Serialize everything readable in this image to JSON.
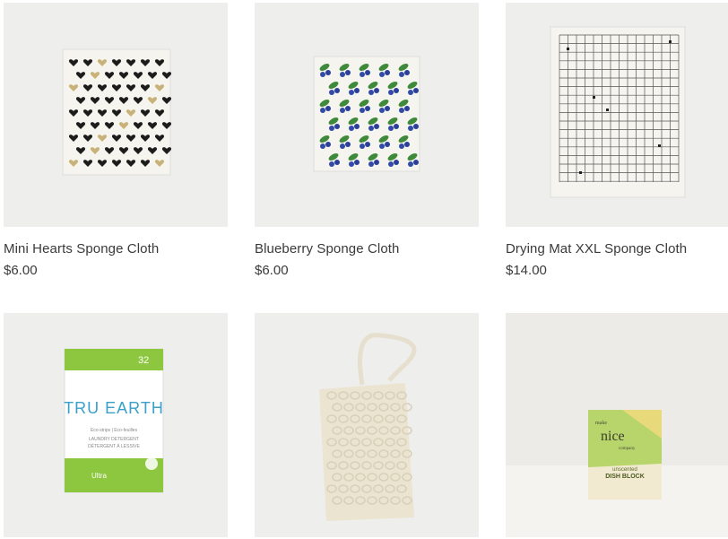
{
  "products": [
    {
      "title": "Mini Hearts Sponge Cloth",
      "price": "$6.00",
      "image": "mini-hearts-sponge-cloth-image"
    },
    {
      "title": "Blueberry Sponge Cloth",
      "price": "$6.00",
      "image": "blueberry-sponge-cloth-image"
    },
    {
      "title": "Drying Mat XXL Sponge Cloth",
      "price": "$14.00",
      "image": "drying-mat-sponge-cloth-image"
    },
    {
      "title": "",
      "price": "",
      "image": "tru-earth-laundry-strips-image"
    },
    {
      "title": "",
      "price": "",
      "image": "sisal-soap-bag-image"
    },
    {
      "title": "",
      "price": "",
      "image": "dish-block-image"
    }
  ],
  "packaging": {
    "truearth_brand": "TRU EARTH",
    "truearth_count": "32",
    "truearth_line1": "Eco-strips | Eco-feuilles",
    "truearth_line2": "LAUNDRY DETERGENT",
    "truearth_line3": "DÉTERGENT À LESSIVE",
    "truearth_variant": "Ultra",
    "dishblock_brand_top": "make",
    "dishblock_brand_main": "nice",
    "dishblock_brand_bottom": "company",
    "dishblock_variant": "unscented",
    "dishblock_product": "DISH BLOCK"
  },
  "colors": {
    "image_bg": "#eeeeec",
    "text": "#3a3a3a",
    "truearth_green": "#8dc63f",
    "truearth_blue": "#3aa0c9",
    "dishblock_green": "#b7d56b"
  }
}
